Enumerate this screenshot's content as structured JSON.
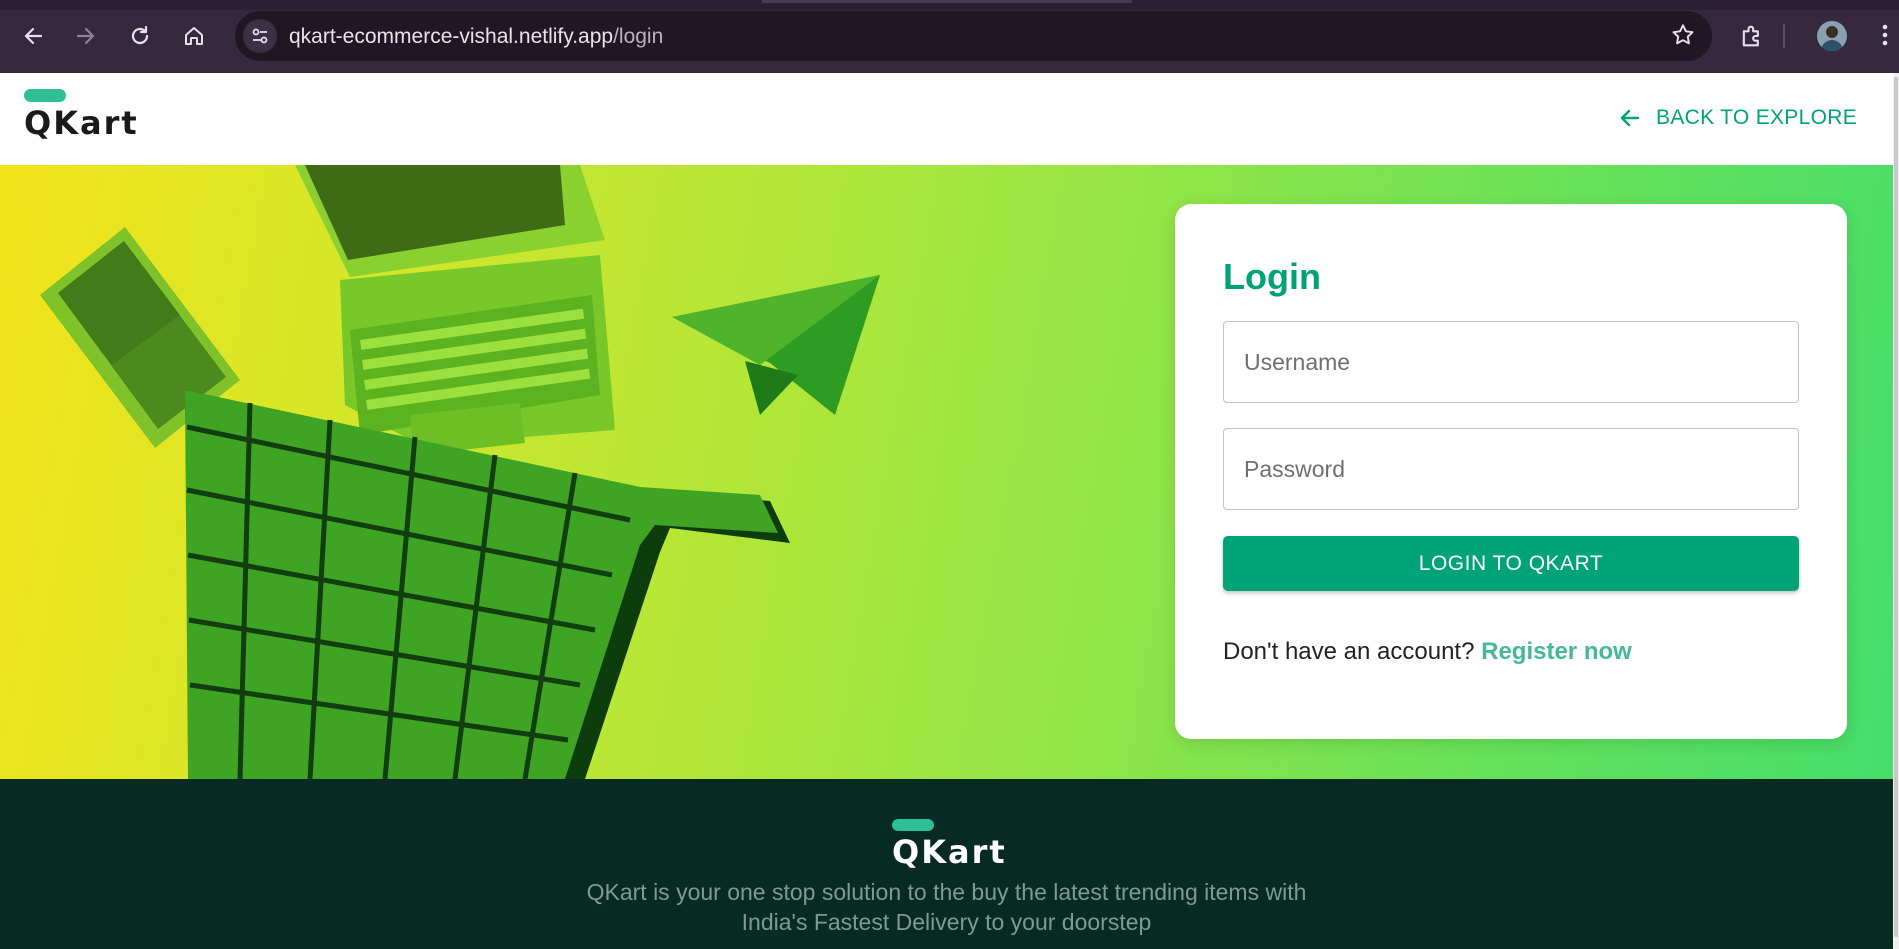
{
  "browser": {
    "url_domain": "qkart-ecommerce-vishal.netlify.app",
    "url_path": "/login",
    "icons": [
      "back-icon",
      "forward-icon",
      "reload-icon",
      "home-icon",
      "site-info-icon",
      "bookmark-star-icon",
      "extensions-icon",
      "profile-avatar",
      "menu-kebab-icon"
    ]
  },
  "header": {
    "logo_text": "QKart",
    "back_label": "BACK TO EXPLORE"
  },
  "login": {
    "title": "Login",
    "username_placeholder": "Username",
    "password_placeholder": "Password",
    "button_label": "LOGIN TO QKART",
    "register_prompt": "Don't have an account?",
    "register_link": "Register now"
  },
  "footer": {
    "logo_text": "QKart",
    "desc_line1": "QKart is your one stop solution to the buy the latest trending items with",
    "desc_line2": "India's Fastest Delivery to your doorstep"
  },
  "colors": {
    "brand": "#00a278",
    "brand_light": "#2fbf95",
    "footer_bg": "#072a22"
  }
}
